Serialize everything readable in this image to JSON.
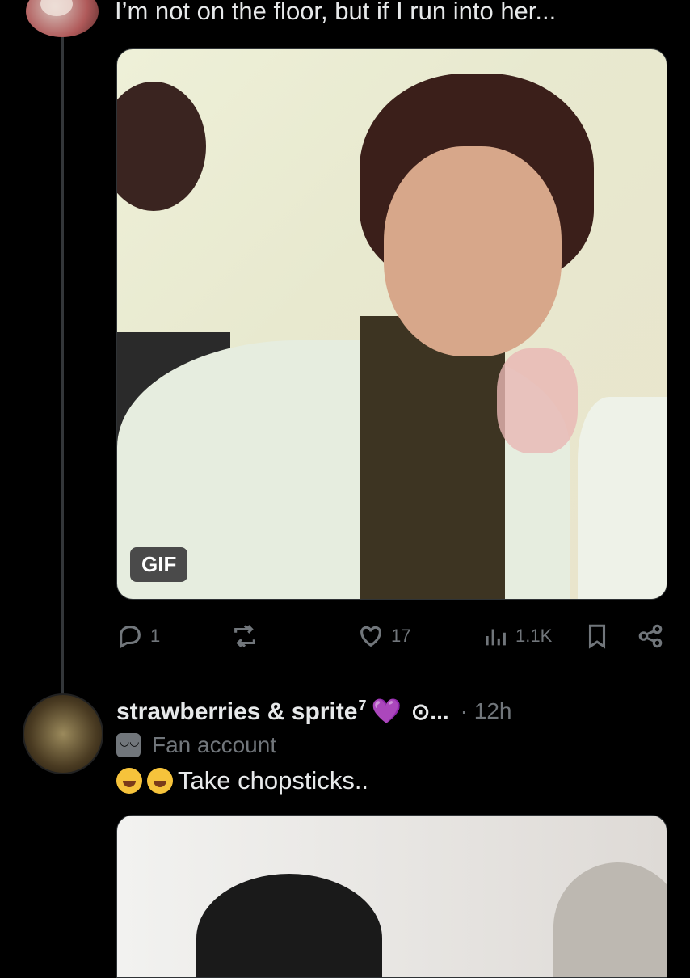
{
  "top_tweet": {
    "text": "I’m not on the floor, but if I run into her...",
    "media": {
      "badge": "GIF"
    },
    "actions": {
      "reply_count": "1",
      "retweet_count": "",
      "like_count": "17",
      "views_count": "1.1K"
    }
  },
  "reply_tweet": {
    "display_name": "strawberries & sprite",
    "superscript": "7",
    "emoji": "💜",
    "truncated_handle": "⊙...",
    "time": "· 12h",
    "label": "Fan account",
    "text": "Take chopsticks.."
  }
}
